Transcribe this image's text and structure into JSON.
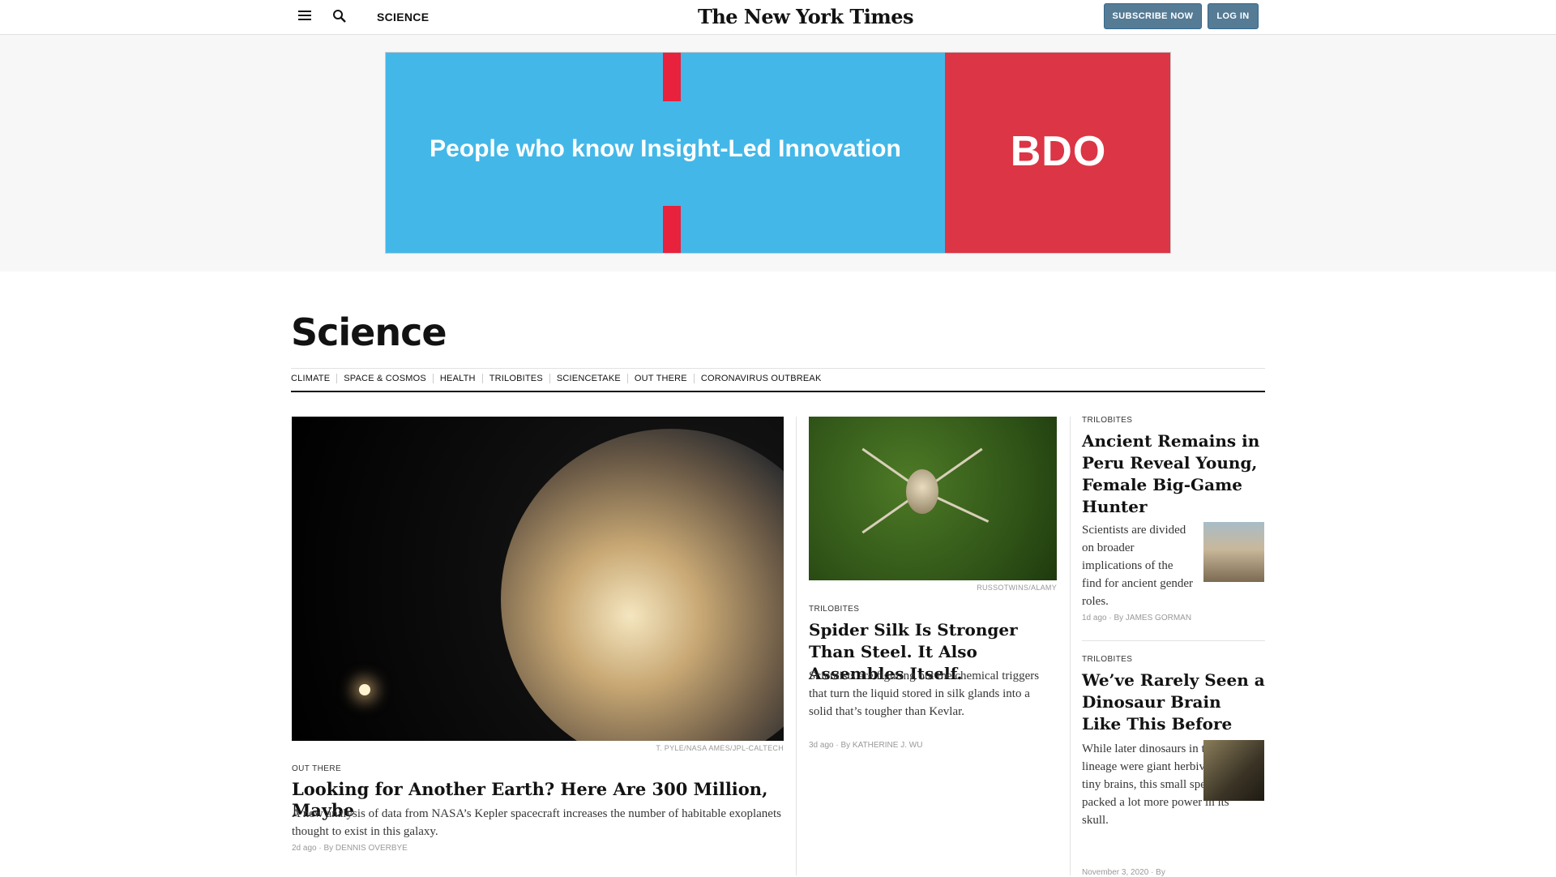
{
  "topbar": {
    "section_label": "SCIENCE",
    "logo": "The New York Times",
    "subscribe_label": "SUBSCRIBE NOW",
    "login_label": "LOG IN"
  },
  "ad": {
    "tagline": "People who know Insight-Led Innovation",
    "brand": "BDO",
    "colors": {
      "left": "#43b8e8",
      "right": "#dc3545"
    }
  },
  "section": {
    "title": "Science",
    "subnav": [
      "CLIMATE",
      "SPACE & COSMOS",
      "HEALTH",
      "TRILOBITES",
      "SCIENCETAKE",
      "OUT THERE",
      "CORONAVIRUS OUTBREAK"
    ]
  },
  "lead": {
    "credit": "T. PYLE/NASA AMES/JPL-CALTECH",
    "kicker": "OUT THERE",
    "headline": "Looking for Another Earth? Here Are 300 Million, Maybe",
    "summary": "A new analysis of data from NASA’s Kepler spacecraft increases the number of habitable exoplanets thought to exist in this galaxy.",
    "time": "2d ago",
    "byline": "By DENNIS OVERBYE"
  },
  "middle": {
    "credit": "RUSSOTWINS/ALAMY",
    "kicker": "TRILOBITES",
    "headline": "Spider Silk Is Stronger Than Steel. It Also Assembles Itself.",
    "summary": "Scientists are figuring out the chemical triggers that turn the liquid stored in silk glands into a solid that’s tougher than Kevlar.",
    "time": "3d ago",
    "byline": "By KATHERINE J. WU"
  },
  "right": [
    {
      "kicker": "TRILOBITES",
      "headline": "Ancient Remains in Peru Reveal Young, Female Big-Game Hunter",
      "summary": "Scientists are divided on broader implications of the find for ancient gender roles.",
      "time": "1d ago",
      "byline": "By JAMES GORMAN"
    },
    {
      "kicker": "TRILOBITES",
      "headline": "We’ve Rarely Seen a Dinosaur Brain Like This Before",
      "summary": "While later dinosaurs in this lineage were giant herbivores with tiny brains, this small species packed a lot more power in its skull.",
      "time": "November 3, 2020",
      "byline": "By"
    }
  ]
}
